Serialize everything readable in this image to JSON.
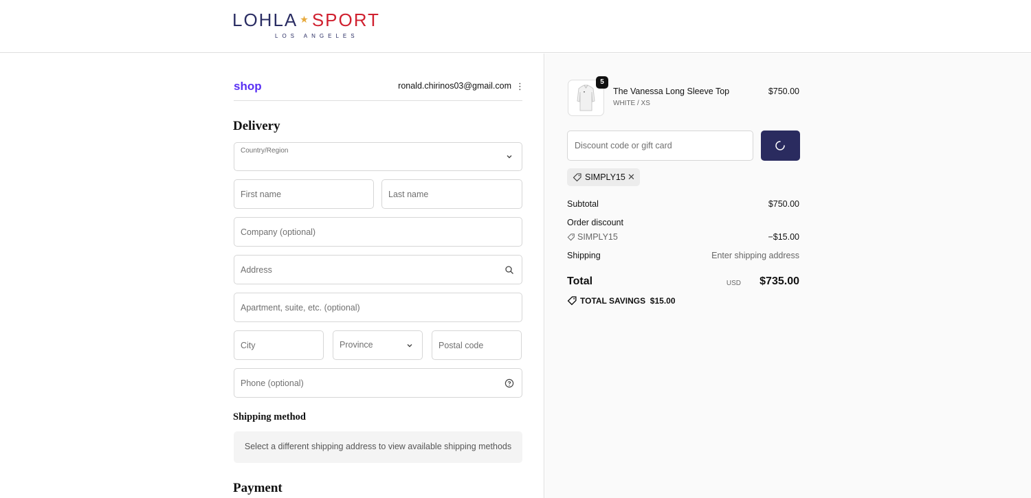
{
  "brand": {
    "name_part1": "LOHLA",
    "name_part2": "SPORT",
    "tagline": "LOS ANGELES",
    "colors": {
      "navy": "#2a2d63",
      "red": "#d0202f",
      "star": "#e7a93b"
    }
  },
  "account": {
    "shop_label": "shop",
    "email": "ronald.chirinos03@gmail.com",
    "menu_icon": "kebab-menu-icon"
  },
  "delivery": {
    "heading": "Delivery",
    "country_label": "Country/Region",
    "first_name_placeholder": "First name",
    "last_name_placeholder": "Last name",
    "company_placeholder": "Company (optional)",
    "address_placeholder": "Address",
    "apartment_placeholder": "Apartment, suite, etc. (optional)",
    "city_placeholder": "City",
    "province_placeholder": "Province",
    "postal_placeholder": "Postal code",
    "phone_placeholder": "Phone (optional)"
  },
  "shipping_method": {
    "heading": "Shipping method",
    "note": "Select a different shipping address to view available shipping methods"
  },
  "payment": {
    "heading": "Payment"
  },
  "order": {
    "product": {
      "quantity": "5",
      "name": "The Vanessa Long Sleeve Top",
      "variant": "WHITE / XS",
      "price": "$750.00"
    },
    "discount_placeholder": "Discount code or gift card",
    "applied_code": "SIMPLY15",
    "subtotal_label": "Subtotal",
    "subtotal_value": "$750.00",
    "order_discount_label": "Order discount",
    "discount_code": "SIMPLY15",
    "discount_value": "−$15.00",
    "shipping_label": "Shipping",
    "shipping_value": "Enter shipping address",
    "total_label": "Total",
    "total_currency": "USD",
    "total_value": "$735.00",
    "savings_label": "TOTAL SAVINGS",
    "savings_value": "$15.00",
    "accent_button_color": "#2a2b5f",
    "shop_pay_color": "#5a31f4"
  }
}
